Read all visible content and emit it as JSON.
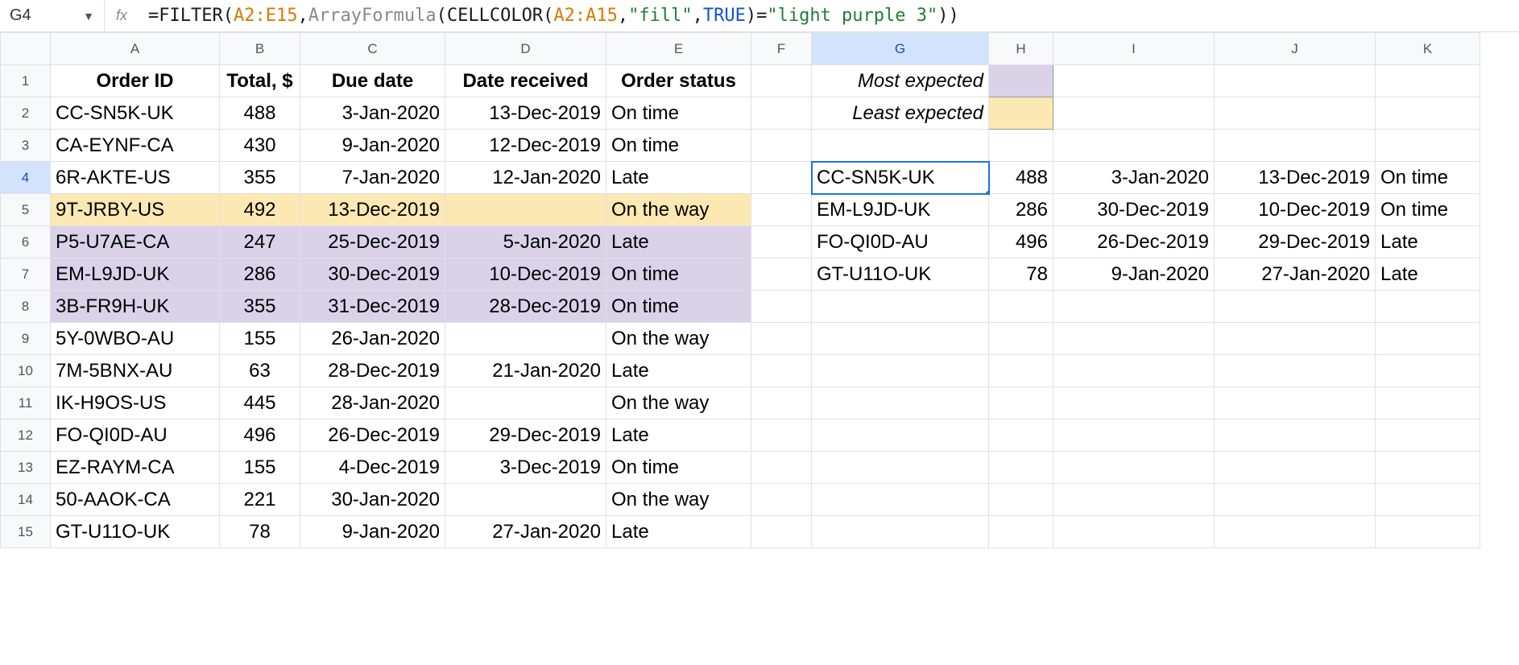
{
  "nameBox": "G4",
  "fxLabel": "fx",
  "formula": {
    "eq": "=",
    "fn1": "FILTER",
    "open1": "(",
    "range1": "A2:E15",
    "comma1": ",",
    "fn2": "ArrayFormula",
    "open2": "(",
    "fn3": "CELLCOLOR",
    "open3": "(",
    "range2": "A2:A15",
    "comma2": ",",
    "str1": "\"fill\"",
    "comma3": ",",
    "const1": "TRUE",
    "close3": ")",
    "eqop": "=",
    "str2": "\"light purple 3\"",
    "close2": ")",
    "close1": ")"
  },
  "columns": [
    "A",
    "B",
    "C",
    "D",
    "E",
    "F",
    "G",
    "H",
    "I",
    "J",
    "K"
  ],
  "rowNumbers": [
    "1",
    "2",
    "3",
    "4",
    "5",
    "6",
    "7",
    "8",
    "9",
    "10",
    "11",
    "12",
    "13",
    "14",
    "15"
  ],
  "colWidths": {
    "rowHdr": 62,
    "A": 210,
    "B": 100,
    "C": 180,
    "D": 200,
    "E": 180,
    "F": 75,
    "G": 220,
    "H": 80,
    "I": 200,
    "J": 200,
    "K": 130
  },
  "headers": {
    "A": "Order ID",
    "B": "Total, $",
    "C": "Due date",
    "D": "Date received",
    "E": "Order status"
  },
  "legend": {
    "most": "Most expected",
    "least": "Least expected"
  },
  "rows": [
    {
      "A": "CC-SN5K-UK",
      "B": "488",
      "C": "3-Jan-2020",
      "D": "13-Dec-2019",
      "E": "On time",
      "fill": ""
    },
    {
      "A": "CA-EYNF-CA",
      "B": "430",
      "C": "9-Jan-2020",
      "D": "12-Dec-2019",
      "E": "On time",
      "fill": ""
    },
    {
      "A": "6R-AKTE-US",
      "B": "355",
      "C": "7-Jan-2020",
      "D": "12-Jan-2020",
      "E": "Late",
      "fill": ""
    },
    {
      "A": "9T-JRBY-US",
      "B": "492",
      "C": "13-Dec-2019",
      "D": "",
      "E": "On the way",
      "fill": "yellow"
    },
    {
      "A": "P5-U7AE-CA",
      "B": "247",
      "C": "25-Dec-2019",
      "D": "5-Jan-2020",
      "E": "Late",
      "fill": "purple"
    },
    {
      "A": "EM-L9JD-UK",
      "B": "286",
      "C": "30-Dec-2019",
      "D": "10-Dec-2019",
      "E": "On time",
      "fill": "purple"
    },
    {
      "A": "3B-FR9H-UK",
      "B": "355",
      "C": "31-Dec-2019",
      "D": "28-Dec-2019",
      "E": "On time",
      "fill": "purple"
    },
    {
      "A": "5Y-0WBO-AU",
      "B": "155",
      "C": "26-Jan-2020",
      "D": "",
      "E": "On the way",
      "fill": ""
    },
    {
      "A": "7M-5BNX-AU",
      "B": "63",
      "C": "28-Dec-2019",
      "D": "21-Jan-2020",
      "E": "Late",
      "fill": ""
    },
    {
      "A": "IK-H9OS-US",
      "B": "445",
      "C": "28-Jan-2020",
      "D": "",
      "E": "On the way",
      "fill": ""
    },
    {
      "A": "FO-QI0D-AU",
      "B": "496",
      "C": "26-Dec-2019",
      "D": "29-Dec-2019",
      "E": "Late",
      "fill": ""
    },
    {
      "A": "EZ-RAYM-CA",
      "B": "155",
      "C": "4-Dec-2019",
      "D": "3-Dec-2019",
      "E": "On time",
      "fill": ""
    },
    {
      "A": "50-AAOK-CA",
      "B": "221",
      "C": "30-Jan-2020",
      "D": "",
      "E": "On the way",
      "fill": ""
    },
    {
      "A": "GT-U11O-UK",
      "B": "78",
      "C": "9-Jan-2020",
      "D": "27-Jan-2020",
      "E": "Late",
      "fill": ""
    }
  ],
  "results": [
    {
      "G": "CC-SN5K-UK",
      "H": "488",
      "I": "3-Jan-2020",
      "J": "13-Dec-2019",
      "K": "On time"
    },
    {
      "G": "EM-L9JD-UK",
      "H": "286",
      "I": "30-Dec-2019",
      "J": "10-Dec-2019",
      "K": "On time"
    },
    {
      "G": "FO-QI0D-AU",
      "H": "496",
      "I": "26-Dec-2019",
      "J": "29-Dec-2019",
      "K": "Late"
    },
    {
      "G": "GT-U11O-UK",
      "H": "78",
      "I": "9-Jan-2020",
      "J": "27-Jan-2020",
      "K": "Late"
    }
  ]
}
